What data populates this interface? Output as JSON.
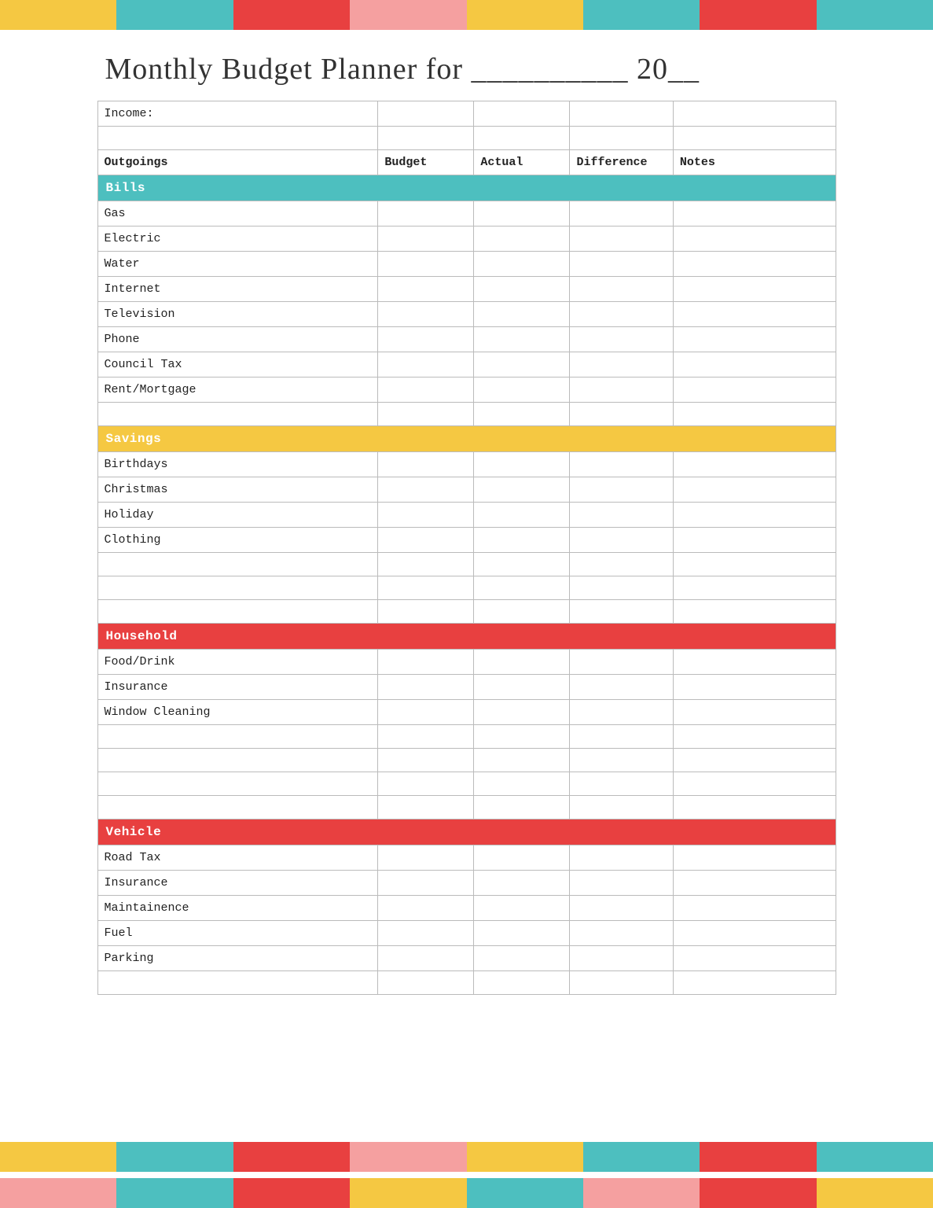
{
  "topBar": {
    "blocks": [
      {
        "color": "#f5c842"
      },
      {
        "color": "#4dbfbf"
      },
      {
        "color": "#e84040"
      },
      {
        "color": "#f5a0a0"
      },
      {
        "color": "#f5c842"
      },
      {
        "color": "#4dbfbf"
      },
      {
        "color": "#e84040"
      },
      {
        "color": "#4dbfbf"
      }
    ]
  },
  "title": "Monthly Budget Planner for __________ 20__",
  "table": {
    "incomeLabel": "Income:",
    "headers": {
      "outgoings": "Outgoings",
      "budget": "Budget",
      "actual": "Actual",
      "difference": "Difference",
      "notes": "Notes"
    },
    "sections": [
      {
        "name": "Bills",
        "colorClass": "section-bills",
        "rows": [
          "Gas",
          "Electric",
          "Water",
          "Internet",
          "Television",
          "Phone",
          "Council Tax",
          "Rent/Mortgage",
          ""
        ]
      },
      {
        "name": "Savings",
        "colorClass": "section-savings",
        "rows": [
          "Birthdays",
          "Christmas",
          "Holiday",
          "Clothing",
          "",
          "",
          ""
        ]
      },
      {
        "name": "Household",
        "colorClass": "section-household",
        "rows": [
          "Food/Drink",
          "Insurance",
          "Window Cleaning",
          "",
          "",
          "",
          ""
        ]
      },
      {
        "name": "Vehicle",
        "colorClass": "section-vehicle",
        "rows": [
          "Road Tax",
          "Insurance",
          "Maintainence",
          "Fuel",
          "Parking",
          ""
        ]
      }
    ]
  },
  "bottomBar1": {
    "blocks": [
      {
        "color": "#f5c842"
      },
      {
        "color": "#4dbfbf"
      },
      {
        "color": "#e84040"
      },
      {
        "color": "#f5a0a0"
      },
      {
        "color": "#f5c842"
      },
      {
        "color": "#4dbfbf"
      },
      {
        "color": "#e84040"
      },
      {
        "color": "#4dbfbf"
      }
    ]
  },
  "bottomBar2": {
    "blocks": [
      {
        "color": "#f5a0a0"
      },
      {
        "color": "#4dbfbf"
      },
      {
        "color": "#e84040"
      },
      {
        "color": "#f5c842"
      },
      {
        "color": "#4dbfbf"
      },
      {
        "color": "#f5a0a0"
      },
      {
        "color": "#e84040"
      },
      {
        "color": "#f5c842"
      }
    ]
  }
}
